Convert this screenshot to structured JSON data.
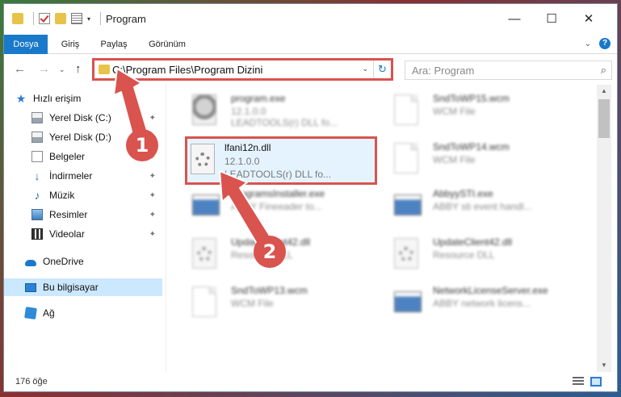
{
  "titlebar": {
    "title": "Program",
    "minimize_glyph": "—",
    "maximize_glyph": "☐",
    "close_glyph": "✕",
    "qa_dropdown_glyph": "▾"
  },
  "ribbon": {
    "tabs": [
      "Dosya",
      "Giriş",
      "Paylaş",
      "Görünüm"
    ],
    "collapse_glyph": "⌄",
    "help_glyph": "?"
  },
  "navbar": {
    "back_glyph": "←",
    "forward_glyph": "→",
    "recent_glyph": "⌄",
    "up_glyph": "↑",
    "address": "C:\\Program Files\\Program Dizini",
    "address_dropdown_glyph": "⌄",
    "refresh_glyph": "↻",
    "search_placeholder": "Ara: Program",
    "search_glyph": "⌕"
  },
  "sidebar": {
    "pin_glyph": "✦",
    "star_glyph": "★",
    "download_glyph": "↓",
    "music_glyph": "♪",
    "items": [
      {
        "label": "Hızlı erişim",
        "icon": "star-icon"
      },
      {
        "label": "Yerel Disk (C:)",
        "icon": "disk-icon",
        "pinned": true
      },
      {
        "label": "Yerel Disk (D:)",
        "icon": "disk-icon",
        "pinned": true
      },
      {
        "label": "Belgeler",
        "icon": "document-icon",
        "pinned": true
      },
      {
        "label": "İndirmeler",
        "icon": "download-icon",
        "pinned": true
      },
      {
        "label": "Müzik",
        "icon": "music-icon",
        "pinned": true
      },
      {
        "label": "Resimler",
        "icon": "pictures-icon",
        "pinned": true
      },
      {
        "label": "Videolar",
        "icon": "videos-icon",
        "pinned": true
      },
      {
        "label": "OneDrive",
        "icon": "onedrive-icon"
      },
      {
        "label": "Bu bilgisayar",
        "icon": "computer-icon",
        "selected": true
      },
      {
        "label": "Ağ",
        "icon": "network-icon"
      }
    ]
  },
  "files": {
    "left": [
      {
        "name": "program.exe",
        "line2": "12.1.0.0",
        "line3": "LEADTOOLS(r) DLL fo..."
      },
      {
        "name": "lfani12n.dll",
        "line2": "12.1.0.0",
        "line3": "LEADTOOLS(r) DLL fo..."
      },
      {
        "name": "ProgramsInstaller.exe",
        "line2": "ABBY Fineeader to...",
        "line3": ""
      },
      {
        "name": "UpdateClient42.dll",
        "line2": "Resource DLL",
        "line3": ""
      },
      {
        "name": "SndToWP13.wcm",
        "line2": "WCM File",
        "line3": ""
      }
    ],
    "right": [
      {
        "name": "SndToWP15.wcm",
        "line2": "WCM File"
      },
      {
        "name": "SndToWP14.wcm",
        "line2": "WCM File"
      },
      {
        "name": "AbbyySTI.exe",
        "line2": "ABBY sti event handl..."
      },
      {
        "name": "UpdateClient42.dll",
        "line2": "Resource DLL"
      },
      {
        "name": "NetworkLicenseServer.exe",
        "line2": "ABBY network licens..."
      }
    ]
  },
  "scrollbar": {
    "up_glyph": "▲",
    "down_glyph": "▼"
  },
  "status": {
    "item_count": "176 öğe"
  },
  "annotations": {
    "step1": "1",
    "step2": "2"
  },
  "colors": {
    "accent": "#1979ca",
    "highlight": "#d9534f",
    "selected": "#cce8ff"
  }
}
